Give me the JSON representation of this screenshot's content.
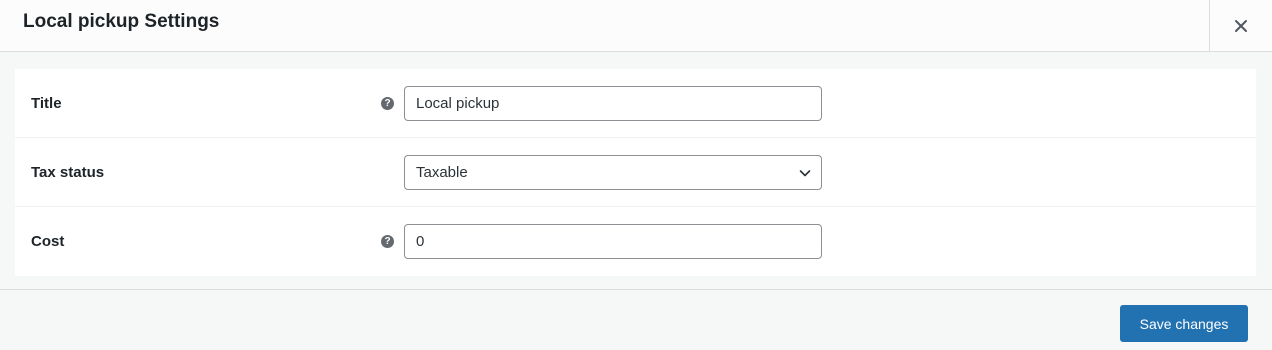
{
  "modal": {
    "title": "Local pickup Settings",
    "close_icon": "close-icon"
  },
  "fields": {
    "title": {
      "label": "Title",
      "value": "Local pickup",
      "help_icon": "help-icon"
    },
    "tax_status": {
      "label": "Tax status",
      "selected": "Taxable",
      "dropdown_icon": "chevron-down-icon"
    },
    "cost": {
      "label": "Cost",
      "value": "0",
      "help_icon": "help-icon"
    }
  },
  "footer": {
    "save_label": "Save changes"
  },
  "colors": {
    "primary": "#2271b1",
    "help_icon": "#646970",
    "border": "#8c8f94"
  }
}
